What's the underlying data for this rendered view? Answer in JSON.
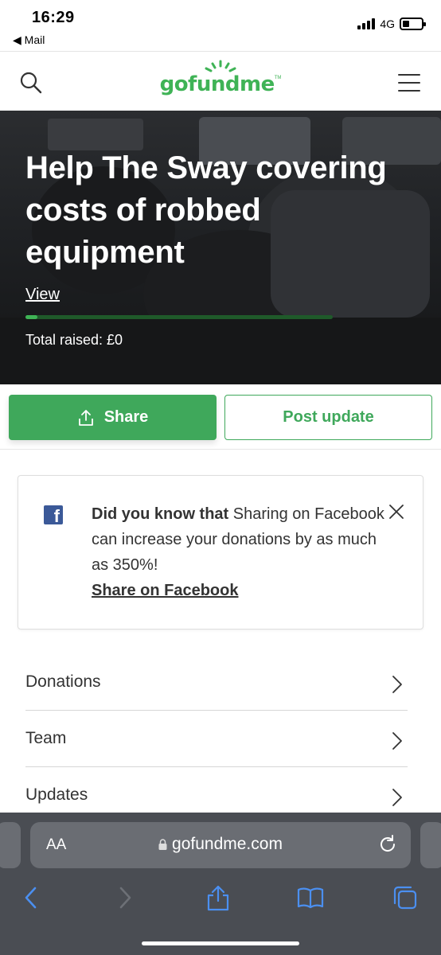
{
  "status": {
    "time": "16:29",
    "back_app": "◀ Mail",
    "network": "4G",
    "signal_bars": 4,
    "battery_level": 0.25
  },
  "header": {
    "logo_text": "gofundme",
    "logo_tm": "TM",
    "brand_color": "#3fb356"
  },
  "hero": {
    "title": "Help The Sway covering costs of robbed equipment",
    "view_link": "View",
    "progress": 0.04,
    "total_raised": "Total raised: £0"
  },
  "actions": {
    "share_label": "Share",
    "post_update_label": "Post update"
  },
  "fb_card": {
    "bold_lead": "Did you know that",
    "body": " Sharing on Facebook can increase your donations by as much as 350%!",
    "link": "Share on Facebook",
    "icon": "facebook-icon"
  },
  "list": {
    "items": [
      {
        "label": "Donations"
      },
      {
        "label": "Team"
      },
      {
        "label": "Updates"
      }
    ]
  },
  "browser": {
    "aa_label": "AA",
    "url": "gofundme.com"
  }
}
